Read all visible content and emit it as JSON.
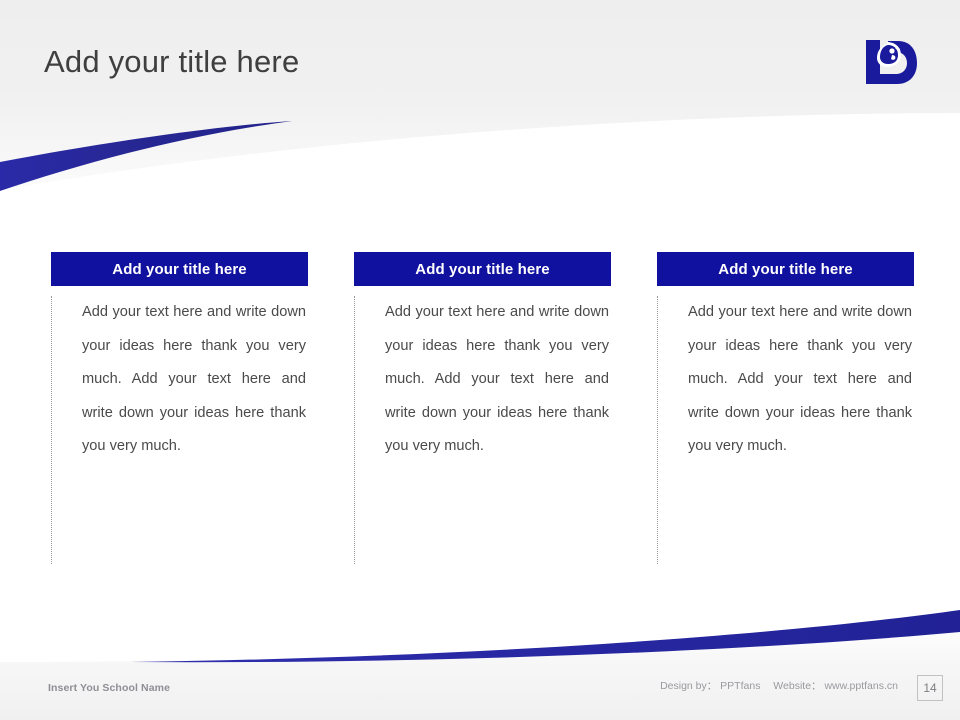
{
  "slide": {
    "title": "Add your title here",
    "logo_name": "school-logo",
    "accent_color": "#1111a0",
    "title_color": "#3f3f3f"
  },
  "columns": [
    {
      "header": "Add your title here",
      "body": "Add your text here and write down your ideas here thank you very much. Add your text here and write down your ideas here thank you very much."
    },
    {
      "header": "Add your title here",
      "body": "Add your text here and write down your ideas here thank you very much. Add your text here and write down your ideas here thank you very much."
    },
    {
      "header": "Add your title here",
      "body": "Add your text here and write down your ideas here thank you very much. Add your text here and write down your ideas here thank you very much."
    }
  ],
  "footer": {
    "school_name": "Insert You School Name",
    "design_by": "Design by： PPTfans",
    "website": "Website： www.pptfans.cn",
    "page_number": "14"
  }
}
